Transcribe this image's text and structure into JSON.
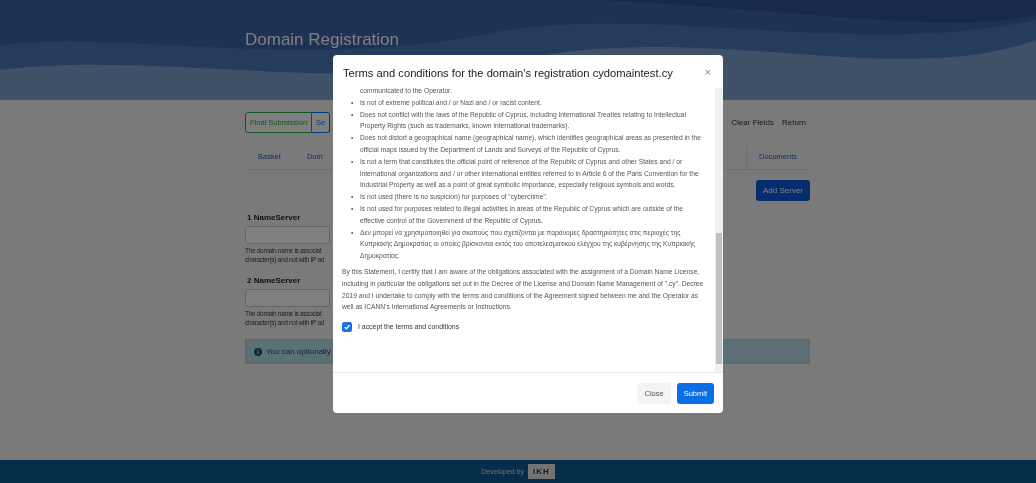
{
  "page": {
    "title": "Domain Registration",
    "actions": [
      {
        "label": "Final Submission",
        "kind": "success"
      },
      {
        "label": "Se",
        "kind": "primary"
      }
    ],
    "right_actions": [
      "Clear Fields",
      "Return"
    ],
    "tabs": [
      {
        "label": "Basket",
        "selected": false
      },
      {
        "label": "Dom",
        "selected": false
      },
      {
        "label": "Documents",
        "selected": false
      }
    ],
    "add_button": "Add Server",
    "nameservers": [
      {
        "label": "1 NameServer",
        "help": [
          "The domain name is associat",
          "character(s) and not with IP ad"
        ]
      },
      {
        "label": "2 NameServer",
        "help": [
          "The domain name is associat",
          "character(s) and not with IP ad"
        ]
      }
    ],
    "alert": "You can optionally"
  },
  "modal": {
    "title": "Terms and conditions for the domain's registration cydomaintest.cy",
    "close": "×",
    "continued_line": "communicated to the Operator.",
    "bullet": "•",
    "bullets": [
      "Is not of extreme political and / or Nazi and / or racist content.",
      "Does not conflict with the laws of the Republic of Cyprus, including International Treaties relating to Intellectual Property Rights (such as trademarks, known international trademarks).",
      "Does not distort a geographical name (geographical name), which identifies geographical areas as presented in the official maps issued by the Department of Lands and Surveys of the Republic of Cyprus.",
      "Is not a term that constitutes the official point of reference of the Republic of Cyprus and other States and / or international organizations and / or other international entities referred to in Article 6 of the Paris Convention for the Industrial Property as well as a point of great symbolic importance, especially religious symbols and words.",
      "Is not used (there is no suspicion) for purposes of \"cybercrime\".",
      "Is not used for purposes related to illegal activities in areas of the Republic of Cyprus which are outside of the effective control of the Government of the Republic of Cyprus.",
      "Δεν μπορεί να χρησιμοποιηθεί για σκοπούς που σχετίζονται με παράνομες δραστηριότητες στις περιοχές της Κυπριακής Δημοκρατίας οι οποίες βρίσκονται εκτός του αποτελεσματικού ελέγχου της κυβέρνησης της Κυπριακής Δημοκρατίας."
    ],
    "statement": "By this Statement, I certify that I am aware of the obligations associated with the assignment of a Domain Name License, including in particular the obligations set out in the Decree of the License and Domain Name Management of \".cy\". Decree 2019 and I undertake to comply with the terms and conditions of the Agreement signed between me and the Operator as well as ICANN's International Agreements or Instructions.",
    "accept": {
      "label": "I accept the terms and conditions",
      "checked": true
    },
    "buttons": [
      {
        "label": "Close",
        "kind": "secondary"
      },
      {
        "label": "Submit",
        "kind": "primary"
      }
    ]
  },
  "footer": {
    "text": "Developed by",
    "logo": "IKH"
  }
}
